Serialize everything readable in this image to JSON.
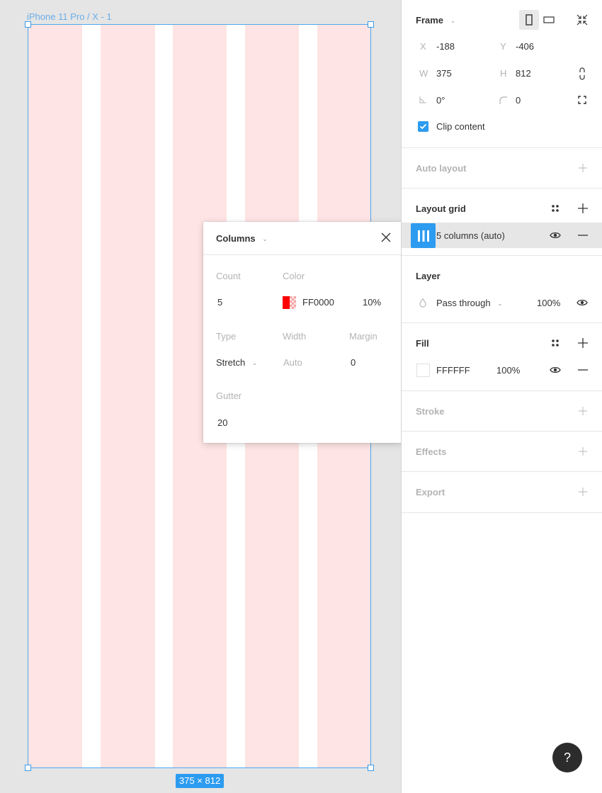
{
  "canvas": {
    "frame_name": "iPhone 11 Pro / X - 1",
    "dimensions_badge": "375 × 812",
    "grid_column_count": 5,
    "grid_color": "#fee4e4",
    "selection_color": "#4ea6ec"
  },
  "popover": {
    "title": "Columns",
    "close_icon": "close-icon",
    "count_label": "Count",
    "count_value": "5",
    "color_label": "Color",
    "color_hex": "FF0000",
    "color_opacity": "10%",
    "color_swatch": "#ff0000",
    "type_label": "Type",
    "type_value": "Stretch",
    "width_label": "Width",
    "width_value": "Auto",
    "margin_label": "Margin",
    "margin_value": "0",
    "gutter_label": "Gutter",
    "gutter_value": "20"
  },
  "panel": {
    "frame": {
      "title": "Frame",
      "x_label": "X",
      "x_value": "-188",
      "y_label": "Y",
      "y_value": "-406",
      "w_label": "W",
      "w_value": "375",
      "h_label": "H",
      "h_value": "812",
      "rotation_value": "0°",
      "radius_value": "0",
      "clip_content_label": "Clip content",
      "clip_content_checked": true
    },
    "auto_layout": {
      "title": "Auto layout"
    },
    "layout_grid": {
      "title": "Layout grid",
      "item_label": "5 columns (auto)"
    },
    "layer": {
      "title": "Layer",
      "blend_mode": "Pass through",
      "opacity": "100%"
    },
    "fill": {
      "title": "Fill",
      "hex": "FFFFFF",
      "opacity": "100%"
    },
    "stroke": {
      "title": "Stroke"
    },
    "effects": {
      "title": "Effects"
    },
    "export": {
      "title": "Export"
    }
  },
  "help": {
    "label": "?"
  }
}
